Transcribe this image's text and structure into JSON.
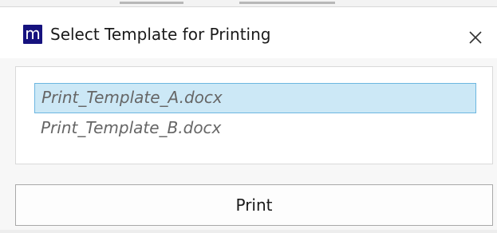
{
  "window": {
    "app_icon_letter": "m",
    "title": "Select Template for Printing",
    "close_icon": "close-icon",
    "accent": "#16127e"
  },
  "templates": {
    "selected_index": 0,
    "items": [
      {
        "label": "Print_Template_A.docx",
        "selected": true
      },
      {
        "label": "Print_Template_B.docx",
        "selected": false
      }
    ],
    "selection_color": "#cce8f6",
    "selection_border": "#6cb6e0"
  },
  "actions": {
    "print_label": "Print"
  }
}
